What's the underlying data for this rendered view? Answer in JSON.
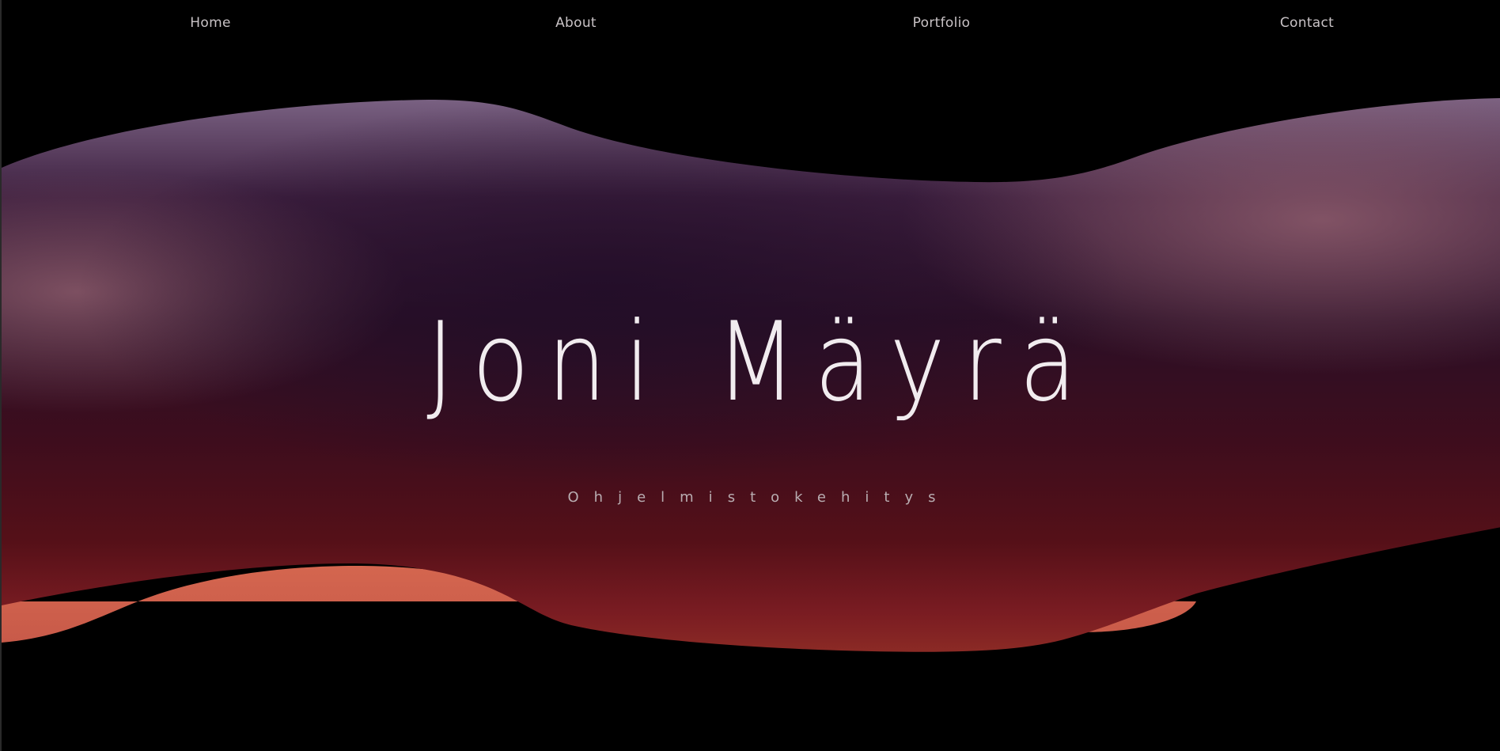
{
  "nav": {
    "items": [
      {
        "label": "Home"
      },
      {
        "label": "About"
      },
      {
        "label": "Portfolio"
      },
      {
        "label": "Contact"
      }
    ]
  },
  "hero": {
    "title": "Joni Mäyrä",
    "subtitle": "Ohjelmistokehitys"
  },
  "colors": {
    "background": "#000000",
    "blob_top": "#7a6283",
    "blob_mid": "#2a1024",
    "blob_deep": "#4f0f1a",
    "blob_bottom": "#cf6450",
    "text_primary": "#f1ecef",
    "text_muted": "#b9adb1"
  }
}
